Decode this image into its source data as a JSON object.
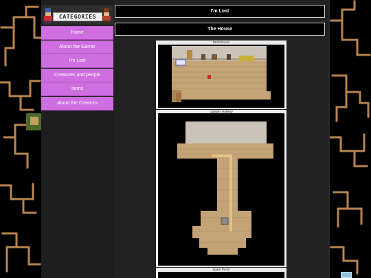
{
  "sidebar": {
    "header_label": "CATEGORIES",
    "nav_items": [
      {
        "label": "Home"
      },
      {
        "label": "About the Game!"
      },
      {
        "label": "I'm Lost"
      },
      {
        "label": "Creatures and people"
      },
      {
        "label": "Items"
      },
      {
        "label": "About the Creators"
      }
    ]
  },
  "page": {
    "title": "I'm Lost",
    "section_title": "The House"
  },
  "rooms": [
    {
      "caption": "Red's Room"
    },
    {
      "caption": "Upstairs Hallway"
    },
    {
      "caption": "Spare Room"
    }
  ],
  "colors": {
    "nav_background": "#cf6ee0",
    "page_background": "#000000",
    "content_background": "#212121",
    "tree_pattern": "#b8854f",
    "floor_wood": "#c4a477"
  },
  "icons": {
    "header_sprites": [
      "pixel-character-icon",
      "pixel-character-icon"
    ],
    "background": "pixel-tree-pattern"
  }
}
